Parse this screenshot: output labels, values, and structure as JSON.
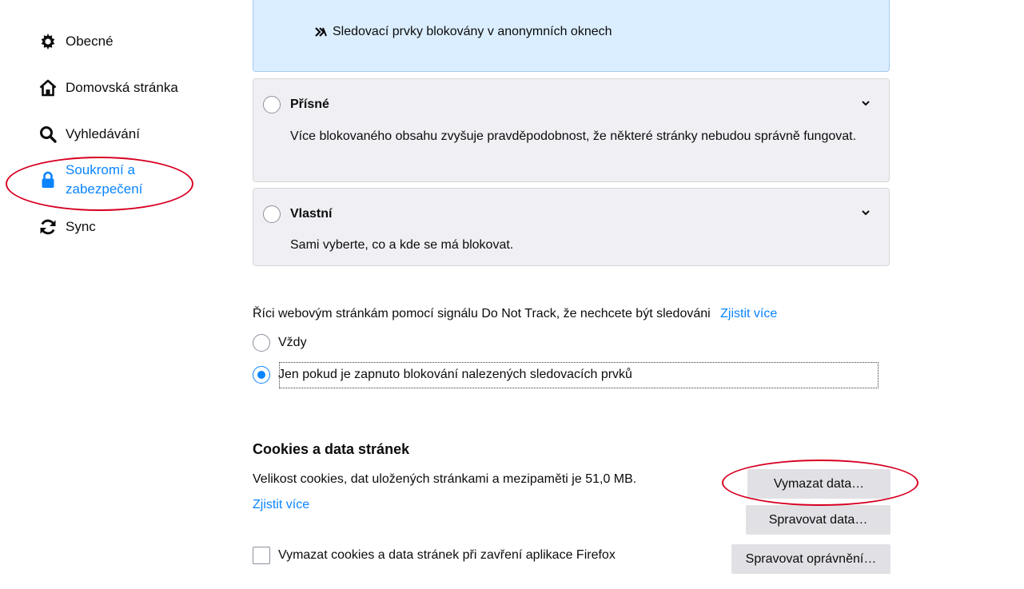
{
  "sidebar": {
    "items": [
      {
        "label": "Obecné",
        "icon": "gear-icon"
      },
      {
        "label": "Domovská stránka",
        "icon": "home-icon"
      },
      {
        "label": "Vyhledávání",
        "icon": "search-icon"
      },
      {
        "label_line1": "Soukromí a",
        "label_line2": "zabezpečení",
        "icon": "lock-icon",
        "selected": true
      },
      {
        "label": "Sync",
        "icon": "sync-icon"
      }
    ]
  },
  "blocking": {
    "standard_bullet": "Sledovací prvky blokovány v anonymních oknech",
    "strict": {
      "title": "Přísné",
      "description": "Více blokovaného obsahu zvyšuje pravděpodobnost, že některé stránky nebudou správně fungovat."
    },
    "custom": {
      "title": "Vlastní",
      "description": "Sami vyberte, co a kde se má blokovat."
    }
  },
  "dnt": {
    "label": "Říci webovým stránkám pomocí signálu Do Not Track, že nechcete být sledováni",
    "learn_more": "Zjistit více",
    "options": [
      "Vždy",
      "Jen pokud je zapnuto blokování nalezených sledovacích prvků"
    ],
    "selected_index": 1
  },
  "cookies": {
    "title": "Cookies a data stránek",
    "size_text": "Velikost cookies, dat uložených stránkami a mezipaměti je 51,0 MB.",
    "learn_more": "Zjistit více",
    "clear_button": "Vymazat data…",
    "manage_data_button": "Spravovat data…",
    "manage_permissions_button": "Spravovat oprávnění…",
    "clear_on_close_label": "Vymazat cookies a data stránek při zavření aplikace Firefox",
    "clear_on_close_checked": false
  },
  "colors": {
    "accent": "#0a84ff",
    "annotation": "#d70022"
  }
}
